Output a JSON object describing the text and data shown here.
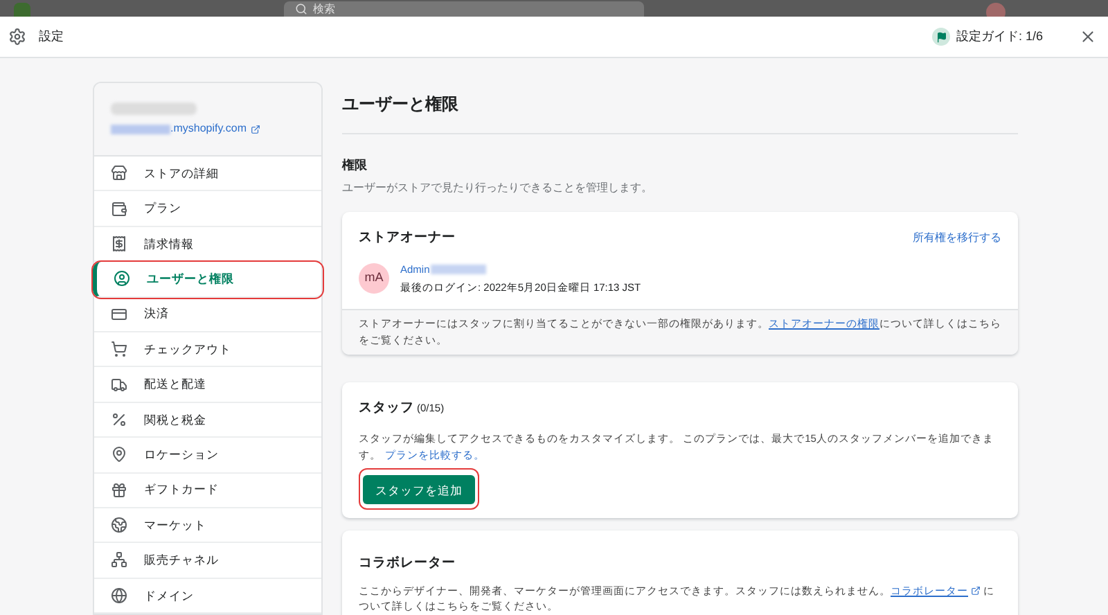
{
  "backdrop": {
    "search": {
      "placeholder": "検索"
    }
  },
  "modal": {
    "title": "設定",
    "guide": "設定ガイド: 1/6"
  },
  "sidebar": {
    "store_domain": ".myshopify.com",
    "items": [
      {
        "label": "ストアの詳細",
        "selected": false
      },
      {
        "label": "プラン",
        "selected": false
      },
      {
        "label": "請求情報",
        "selected": false
      },
      {
        "label": "ユーザーと権限",
        "selected": true
      },
      {
        "label": "決済",
        "selected": false
      },
      {
        "label": "チェックアウト",
        "selected": false
      },
      {
        "label": "配送と配達",
        "selected": false
      },
      {
        "label": "関税と税金",
        "selected": false
      },
      {
        "label": "ロケーション",
        "selected": false
      },
      {
        "label": "ギフトカード",
        "selected": false
      },
      {
        "label": "マーケット",
        "selected": false
      },
      {
        "label": "販売チャネル",
        "selected": false
      },
      {
        "label": "ドメイン",
        "selected": false
      }
    ]
  },
  "page": {
    "title": "ユーザーと権限",
    "section_title": "権限",
    "section_desc": "ユーザーがストアで見たり行ったりできることを管理します。",
    "owner_card": {
      "title": "ストアオーナー",
      "action": "所有権を移行する",
      "avatar": "mA",
      "name": "Admin",
      "last_login": "最後のログイン: 2022年5月20日金曜日 17:13 JST",
      "note": "ストアオーナーにはスタッフに割り当てることができない一部の権限があります。",
      "note_link": "ストアオーナーの権限",
      "note_end": "について詳しくはこちらをご覧ください。"
    },
    "staff_card": {
      "title": "スタッフ",
      "count": "(0/15)",
      "desc": "スタッフが編集してアクセスできるものをカスタマイズします。 このプランでは、最大で15人のスタッフメンバーを追加できます。",
      "link": "プランを比較する。",
      "button": "スタッフを追加"
    },
    "collab_card": {
      "title": "コラボレーター",
      "desc": "ここからデザイナー、開発者、マーケターが管理画面にアクセスできます。スタッフには数えられません。",
      "link": "コラボレーター",
      "desc_end": "について詳しくはこちらをご覧ください。"
    }
  }
}
